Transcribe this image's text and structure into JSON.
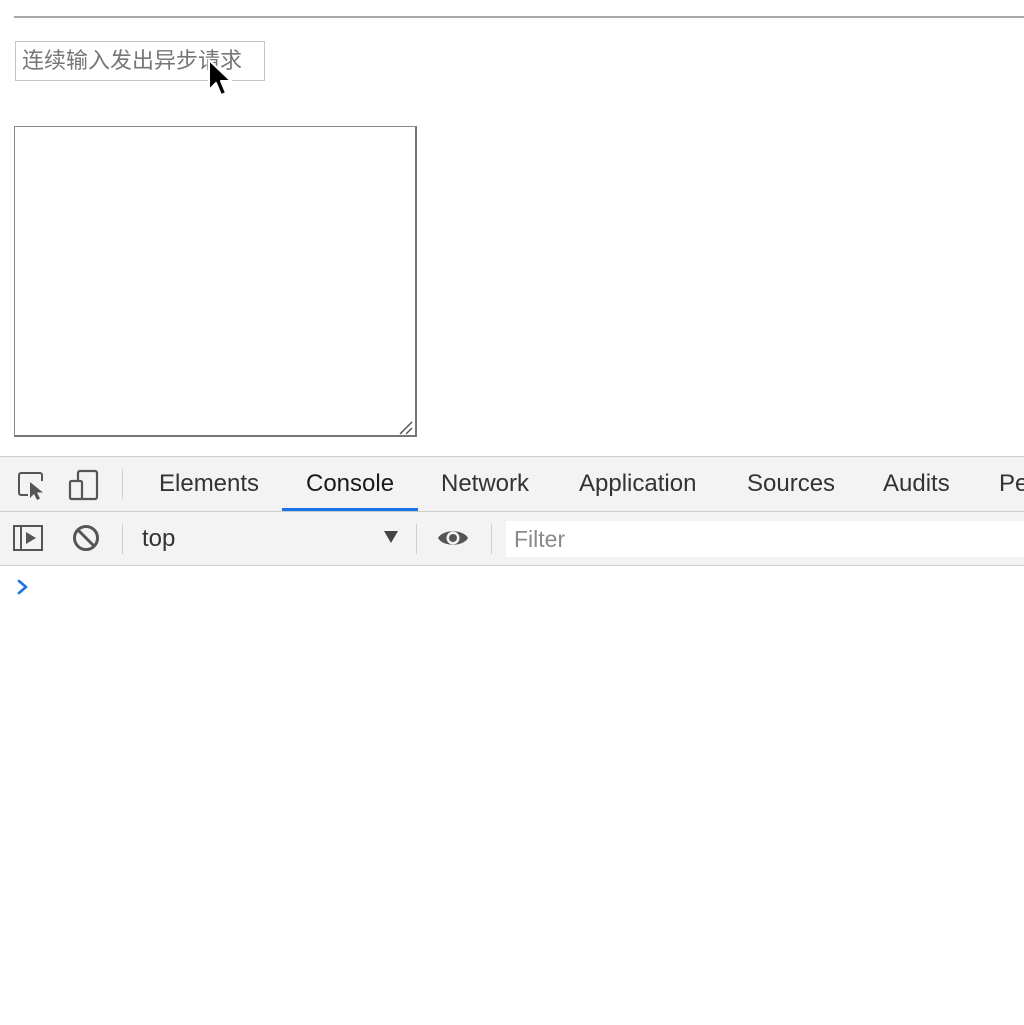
{
  "page": {
    "input_placeholder": "连续输入发出异步请求",
    "textarea_value": ""
  },
  "devtools": {
    "tabs": [
      {
        "label": "Elements",
        "active": false
      },
      {
        "label": "Console",
        "active": true
      },
      {
        "label": "Network",
        "active": false
      },
      {
        "label": "Application",
        "active": false
      },
      {
        "label": "Sources",
        "active": false
      },
      {
        "label": "Audits",
        "active": false
      },
      {
        "label": "Pe",
        "active": false
      }
    ],
    "toolbar": {
      "context": "top",
      "filter_placeholder": "Filter"
    },
    "icons": {
      "inspect": "inspect-element-icon",
      "device": "device-toggle-icon",
      "sidebar": "sidebar-toggle-icon",
      "clear": "clear-console-icon",
      "eye": "live-expression-icon",
      "prompt": "console-prompt-icon",
      "cursor": "mouse-cursor-icon"
    },
    "colors": {
      "accent": "#1a73e8",
      "toolbar_bg": "#f3f3f3"
    }
  }
}
